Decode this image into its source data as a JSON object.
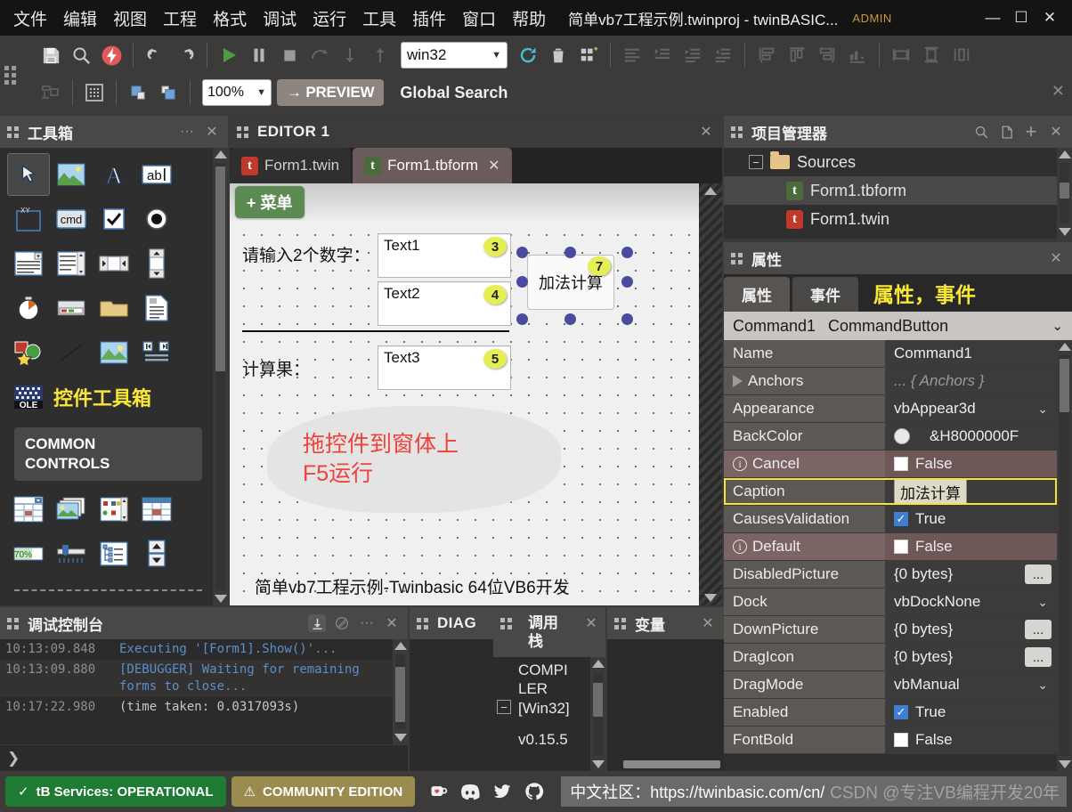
{
  "window": {
    "menus": [
      "文件",
      "编辑",
      "视图",
      "工程",
      "格式",
      "调试",
      "运行",
      "工具",
      "插件",
      "窗口",
      "帮助"
    ],
    "title": "简单vb7工程示例.twinproj - twinBASIC...",
    "admin": "ADMIN",
    "minimize": "—",
    "maximize": "☐",
    "close": "✕"
  },
  "toolbar": {
    "build_target": "win32",
    "zoom": "100%",
    "preview_label": "→ PREVIEW",
    "global_search": "Global Search",
    "close_x": "✕"
  },
  "toolbox": {
    "title": "工具箱",
    "more": "···",
    "close": "✕",
    "note": "控件工具箱",
    "common_controls_line1": "COMMON",
    "common_controls_line2": "CONTROLS",
    "icons": [
      "pointer-icon",
      "picturebox-icon",
      "label-icon",
      "textbox-icon",
      "frame-icon",
      "commandbutton-icon",
      "checkbox-icon",
      "optionbutton-icon",
      "combobox-icon",
      "listbox-icon",
      "hscrollbar-icon",
      "vscrollbar-icon",
      "timer-icon",
      "drivelistbox-icon",
      "dirlistbox-icon",
      "filelistbox-icon",
      "shape-icon",
      "line-icon",
      "image-icon",
      "data-icon",
      "ole-icon"
    ],
    "common_icons": [
      "monthview-icon",
      "imagelist-icon",
      "listview-icon",
      "flexgrid-icon",
      "progressbar-icon",
      "slider-icon",
      "treeview-icon",
      "updown-icon"
    ]
  },
  "editor": {
    "title": "EDITOR 1",
    "close": "✕",
    "tabs": [
      {
        "label": "Form1.twin",
        "active": false,
        "logo": "t",
        "closable": false
      },
      {
        "label": "Form1.tbform",
        "active": true,
        "logo": "t",
        "closable": true
      }
    ],
    "tab_close": "✕",
    "designer": {
      "menu_button": "+ 菜单",
      "label_input": "请输入2个数字：",
      "label_result": "计算果：",
      "text1": "Text1",
      "text2": "Text2",
      "text3": "Text3",
      "button_caption": "加法计算",
      "badge_text1": "3",
      "badge_text2": "4",
      "badge_text3": "5",
      "badge_button": "7",
      "hint_line1": "拖控件到窗体上",
      "hint_line2": "F5运行",
      "footer": "简单vb7工程示例-Twinbasic 64位VB6开发"
    }
  },
  "project_manager": {
    "title": "项目管理器",
    "search_icon": "search-icon",
    "newfile_icon": "new-file-icon",
    "add_icon": "+",
    "close": "✕",
    "nodes": [
      {
        "label": "Sources",
        "type": "folder",
        "expander": "−",
        "indent": 0,
        "selected": false
      },
      {
        "label": "Form1.tbform",
        "type": "file",
        "indent": 1,
        "selected": true,
        "logo_color": "green"
      },
      {
        "label": "Form1.twin",
        "type": "file",
        "indent": 1,
        "selected": false,
        "logo_color": "red"
      }
    ]
  },
  "properties": {
    "title": "属性",
    "close": "✕",
    "tabs": [
      {
        "label": "属性",
        "active": true
      },
      {
        "label": "事件",
        "active": false
      }
    ],
    "note": "属性，事件",
    "object_name": "Command1",
    "object_type": "CommandButton",
    "object_chevron": "⌄",
    "rows": [
      {
        "name": "Name",
        "value": "Command1",
        "kind": "text"
      },
      {
        "name": "Anchors",
        "value": "... { Anchors }",
        "kind": "expand",
        "muted": true
      },
      {
        "name": "Appearance",
        "value": "vbAppear3d",
        "kind": "dropdown"
      },
      {
        "name": "BackColor",
        "value": "&H8000000F",
        "kind": "color"
      },
      {
        "name": "Cancel",
        "value": "False",
        "kind": "checkbox",
        "checked": false,
        "warn": true
      },
      {
        "name": "Caption",
        "value": "加法计算",
        "kind": "highlight"
      },
      {
        "name": "CausesValidation",
        "value": "True",
        "kind": "checkbox",
        "checked": true
      },
      {
        "name": "Default",
        "value": "False",
        "kind": "checkbox",
        "checked": false,
        "warn": true
      },
      {
        "name": "DisabledPicture",
        "value": "{0 bytes}",
        "kind": "ellipsis"
      },
      {
        "name": "Dock",
        "value": "vbDockNone",
        "kind": "dropdown"
      },
      {
        "name": "DownPicture",
        "value": "{0 bytes}",
        "kind": "ellipsis"
      },
      {
        "name": "DragIcon",
        "value": "{0 bytes}",
        "kind": "ellipsis"
      },
      {
        "name": "DragMode",
        "value": "vbManual",
        "kind": "dropdown"
      },
      {
        "name": "Enabled",
        "value": "True",
        "kind": "checkbox",
        "checked": true
      },
      {
        "name": "FontBold",
        "value": "False",
        "kind": "checkbox",
        "checked": false
      }
    ],
    "ellipsis_label": "...",
    "dropdown_chevron": "⌄"
  },
  "console": {
    "title": "调试控制台",
    "download_icon": "download-icon",
    "clear_icon": "clear-icon",
    "more": "···",
    "close": "✕",
    "lines": [
      {
        "ts": "10:13:09.848",
        "msg": "Executing '[Form1].Show()'...",
        "style": "link"
      },
      {
        "ts": "10:13:09.880",
        "msg": "[DEBUGGER] Waiting for remaining forms to close...",
        "style": "link"
      },
      {
        "ts": "10:17:22.980",
        "msg": "(time taken: 0.0317093s)",
        "style": "plain"
      }
    ],
    "prompt": "❯"
  },
  "diag": {
    "title": "DIAG"
  },
  "call_stack": {
    "title_line1": "调用",
    "title_line2": "栈",
    "close": "✕",
    "expander": "−",
    "lines": [
      "COMPI",
      "LER",
      "[Win32]",
      "",
      "v0.15.5"
    ]
  },
  "variables": {
    "title": "变量",
    "close": "✕"
  },
  "statusbar": {
    "services_label": "tB Services: OPERATIONAL",
    "services_check": "✓",
    "edition_label": "COMMUNITY EDITION",
    "edition_warn": "⚠",
    "social": [
      "kofi-icon",
      "discord-icon",
      "twitter-icon",
      "github-icon"
    ],
    "community_link": "中文社区：https://twinbasic.com/cn/",
    "watermark": "CSDN @专注VB编程开发20年"
  },
  "colors": {
    "accent_yellow": "#fbe836",
    "green_ok": "#1f7a33",
    "warn_gold": "#9a8c4e",
    "handle_blue": "#4a4a9e",
    "badge_yellow": "#e5ef54",
    "hint_red": "#f0413a",
    "caption_highlight": "#f2e632"
  }
}
